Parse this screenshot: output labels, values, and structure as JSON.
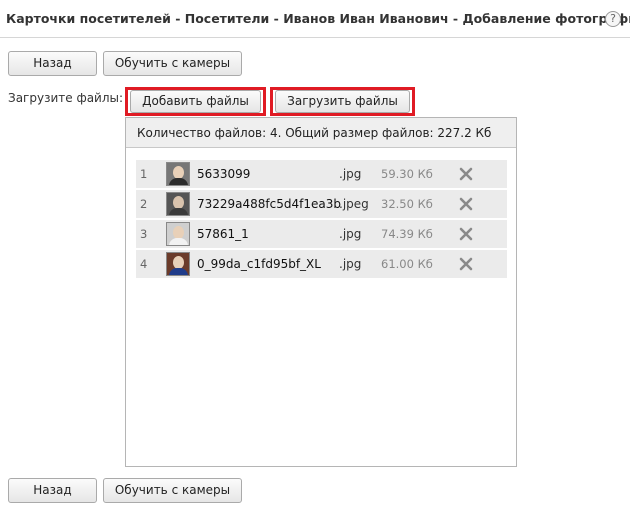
{
  "title": "Карточки посетителей - Посетители - Иванов Иван Иванович - Добавление фотографий",
  "help_icon": "question-mark-icon",
  "top_buttons": {
    "back": "Назад",
    "train_camera": "Обучить с камеры"
  },
  "upload": {
    "label": "Загрузите файлы:",
    "add_files": "Добавить файлы",
    "upload_files": "Загрузить файлы",
    "highlight_color": "#e01b24"
  },
  "panel": {
    "summary": "Количество файлов: 4. Общий размер файлов: 227.2 Кб",
    "files": [
      {
        "num": "1",
        "name": "5633099",
        "ext": ".jpg",
        "size": "59.30 Кб"
      },
      {
        "num": "2",
        "name": "73229a488fc5d4f1ea3b",
        "ext": ".jpeg",
        "size": "32.50 Кб"
      },
      {
        "num": "3",
        "name": "57861_1",
        "ext": ".jpg",
        "size": "74.39 Кб"
      },
      {
        "num": "4",
        "name": "0_99da_c1fd95bf_XL",
        "ext": ".jpg",
        "size": "61.00 Кб"
      }
    ],
    "delete_icon": "close-x-icon"
  },
  "bottom_buttons": {
    "back": "Назад",
    "train_camera": "Обучить с камеры"
  }
}
